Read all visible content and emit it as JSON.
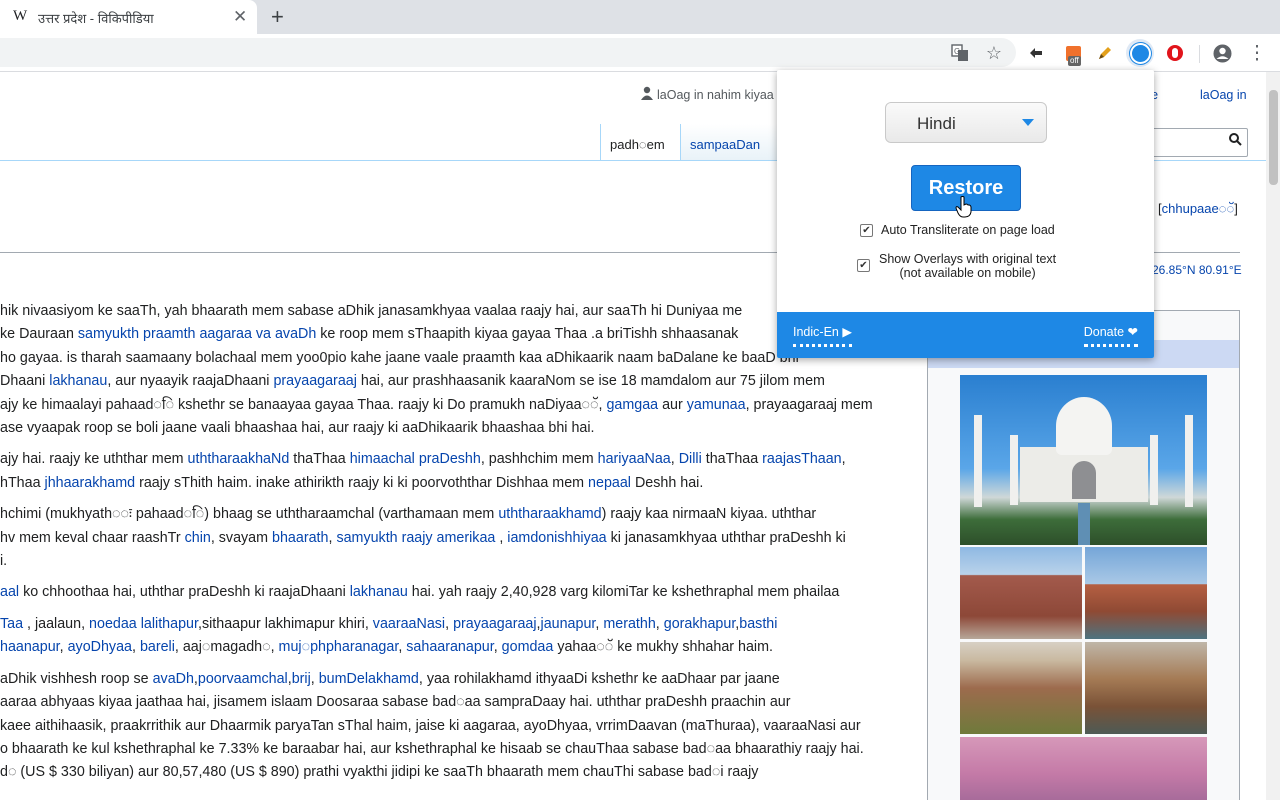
{
  "browser": {
    "tab_favicon": "W",
    "tab_title": "उत्तर प्रदेश - विकिपीडिया",
    "tab_close": "✕",
    "new_tab": "+",
    "toolbar_icons": [
      "translate-icon",
      "star-icon",
      "extension-icon",
      "off-badge-extension-icon",
      "pencil-icon",
      "indic-transliterate-icon",
      "opera-icon",
      "profile-icon",
      "menu-icon"
    ],
    "off_badge": "off",
    "star": "☆",
    "menu": "⋮"
  },
  "wiki": {
    "not_logged_in": "laOag in nahim kiyaa",
    "talk": "vaaae",
    "login": "laOag in",
    "tab_read": "padh◌em",
    "tab_edit": "sampaaDan",
    "hide": "chhupaae◌ॅ",
    "coords": "26.85°N 80.91°E",
    "paragraphs": [
      [
        [
          {
            "t": "hik nivaasiyom ke saaTh, yah bhaarath mem sabase aDhik janasamkhyaa vaalaa raajy hai, aur saaTh hi Duniyaa me"
          }
        ],
        [
          {
            "t": " ke Dauraan "
          },
          {
            "t": "samyukth praamth aagaraa va avaDh",
            "link": true
          },
          {
            "t": " ke roop mem sThaapith kiyaa gayaa Thaa .a briTishh shhaasanak"
          }
        ],
        [
          {
            "t": " ho gayaa. is tharah saamaany bolachaal mem yoo0pio kahe jaane vaale praamth kaa aDhikaarik naam baDalane ke baaD bhi"
          }
        ],
        [
          {
            "t": "Dhaani "
          },
          {
            "t": "lakhanau",
            "link": true
          },
          {
            "t": ", aur nyaayik raajaDhaani "
          },
          {
            "t": "prayaagaraaj",
            "link": true
          },
          {
            "t": " hai, aur prashhaasanik kaaraNom se ise 18 mamdalom aur 75 jilom mem"
          }
        ],
        [
          {
            "t": "ajy ke himaalayi pahaad◌ि kshethr se banaayaa gayaa Thaa. raajy ki Do pramukh naDiyaa◌ॅ, "
          },
          {
            "t": "gamgaa",
            "link": true
          },
          {
            "t": " aur "
          },
          {
            "t": "yamunaa",
            "link": true
          },
          {
            "t": ", prayaagaraaj mem"
          }
        ],
        [
          {
            "t": "ase vyaapak roop se boli jaane vaali bhaashaa hai, aur raajy ki aaDhikaarik bhaashaa bhi hai."
          }
        ]
      ],
      [
        [
          {
            "t": "ajy hai. raajy ke uththar mem "
          },
          {
            "t": "uththaraakhaNd",
            "link": true
          },
          {
            "t": " thaThaa "
          },
          {
            "t": "himaachal praDeshh",
            "link": true
          },
          {
            "t": ", pashhchim mem "
          },
          {
            "t": "hariyaaNaa",
            "link": true
          },
          {
            "t": ", "
          },
          {
            "t": "Dilli",
            "link": true
          },
          {
            "t": " thaThaa "
          },
          {
            "t": "raajasThaan",
            "link": true
          },
          {
            "t": ","
          }
        ],
        [
          {
            "t": "hThaa "
          },
          {
            "t": "jhhaarakhamd",
            "link": true
          },
          {
            "t": " raajy sThith haim. inake athirikth raajy ki ki poorvoththar Dishhaa mem "
          },
          {
            "t": "nepaal",
            "link": true
          },
          {
            "t": " Deshh hai."
          }
        ]
      ],
      [
        [
          {
            "t": "hchimi (mukhyath◌ः pahaad◌ि) bhaag se uththaraamchal (varthamaan mem "
          },
          {
            "t": "uththaraakhamd",
            "link": true
          },
          {
            "t": ") raajy kaa nirmaaN kiyaa. uththar"
          }
        ],
        [
          {
            "t": "hv mem keval chaar raashTr "
          },
          {
            "t": "chin",
            "link": true
          },
          {
            "t": ", svayam "
          },
          {
            "t": "bhaarath",
            "link": true
          },
          {
            "t": ", "
          },
          {
            "t": "samyukth raajy amerikaa",
            "link": true
          },
          {
            "t": " , "
          },
          {
            "t": "iamdonishhiyaa",
            "link": true
          },
          {
            "t": " ki janasamkhyaa uththar praDeshh ki"
          }
        ],
        [
          {
            "t": "i."
          }
        ]
      ],
      [
        [
          {
            "t": "aal",
            "link": true
          },
          {
            "t": " ko chhoothaa hai, uththar praDeshh ki raajaDhaani "
          },
          {
            "t": "lakhanau",
            "link": true
          },
          {
            "t": " hai. yah raajy 2,40,928 varg kilomiTar ke kshethraphal mem phailaa"
          }
        ],
        [
          {
            "t": " "
          }
        ]
      ],
      [
        [
          {
            "t": "Taa",
            "link": true
          },
          {
            "t": " , jaalaun, "
          },
          {
            "t": "noedaa lalithapur",
            "link": true
          },
          {
            "t": ",sithaapur lakhimapur khiri, "
          },
          {
            "t": "vaaraaNasi",
            "link": true
          },
          {
            "t": ", "
          },
          {
            "t": "prayaagaraaj",
            "link": true
          },
          {
            "t": ","
          },
          {
            "t": "jaunapur",
            "link": true
          },
          {
            "t": ", "
          },
          {
            "t": "merathh",
            "link": true
          },
          {
            "t": ", "
          },
          {
            "t": "gorakhapur",
            "link": true
          },
          {
            "t": ","
          },
          {
            "t": "basthi",
            "link": true
          }
        ],
        [
          {
            "t": "haanapur",
            "link": true
          },
          {
            "t": ", "
          },
          {
            "t": "ayoDhyaa",
            "link": true
          },
          {
            "t": ", "
          },
          {
            "t": "bareli",
            "link": true
          },
          {
            "t": ", aaj◌magadh◌, "
          },
          {
            "t": "muj◌phpharanagar",
            "link": true
          },
          {
            "t": ", "
          },
          {
            "t": "sahaaranapur",
            "link": true
          },
          {
            "t": ", "
          },
          {
            "t": "gomdaa",
            "link": true
          },
          {
            "t": " yahaa◌ॅ ke mukhy shhahar haim."
          }
        ]
      ],
      [
        [
          {
            "t": " aDhik vishhesh roop se "
          },
          {
            "t": "avaDh",
            "link": true
          },
          {
            "t": ","
          },
          {
            "t": "poorvaamchal",
            "link": true
          },
          {
            "t": ","
          },
          {
            "t": "brij",
            "link": true
          },
          {
            "t": ", "
          },
          {
            "t": "bumDelakhamd",
            "link": true
          },
          {
            "t": ", yaa rohilakhamd ithyaaDi kshethr ke aaDhaar par jaane"
          }
        ],
        [
          {
            "t": "aaraa abhyaas kiyaa jaathaa hai, jisamem islaam Doosaraa sabase bad◌aa sampraDaay hai. uththar praDeshh praachin aur"
          }
        ],
        [
          {
            "t": " kaee aithihaasik, praakrrithik aur Dhaarmik paryaTan sThal haim, jaise ki aagaraa, ayoDhyaa, vrrimDaavan (maThuraa), vaaraaNasi aur"
          }
        ],
        [
          {
            "t": "o bhaarath ke kul kshethraphal ke 7.33% ke baraabar hai, aur kshethraphal ke hisaab se chauThaa sabase bad◌aa bhaarathiy raajy hai."
          }
        ],
        [
          {
            "t": "d◌ (US $ 330 biliyan) aur 80,57,480 (US $ 890) prathi vyakthi jidipi ke saaTh bhaarath mem chauThi sabase bad◌i raajy"
          }
        ]
      ]
    ]
  },
  "popup": {
    "language": "Hindi",
    "restore_label": "Restore",
    "opt1_checked": "✔",
    "opt1_label": "Auto Transliterate on page load",
    "opt2_checked": "✔",
    "opt2_label_line1": "Show Overlays with original text",
    "opt2_label_line2": "(not available on mobile)",
    "footer_left": "Indic-En ▶",
    "footer_right": "Donate ❤"
  }
}
